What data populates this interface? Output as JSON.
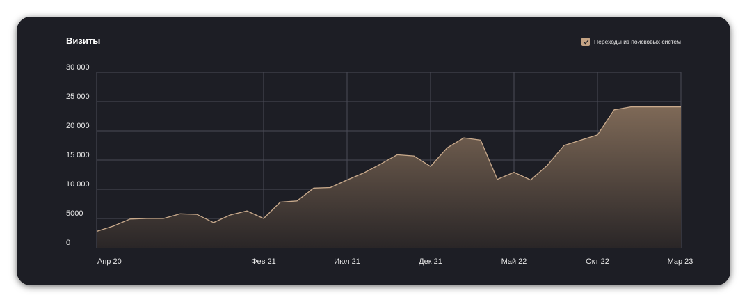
{
  "chart_data": {
    "type": "area",
    "title": "Визиты",
    "series_legend": "Переходы из поисковых систем",
    "ylim": [
      0,
      30000
    ],
    "y_ticks": [
      0,
      5000,
      10000,
      15000,
      20000,
      25000,
      30000
    ],
    "y_tick_labels": [
      "0",
      "5000",
      "10 000",
      "15 000",
      "20 000",
      "25 000",
      "30 000"
    ],
    "x_tick_labels": [
      "Апр 20",
      "Фев 21",
      "Июл 21",
      "Дек 21",
      "Май 22",
      "Окт 22",
      "Мар 23"
    ],
    "x_tick_dates": [
      "2020-04",
      "2021-02",
      "2021-07",
      "2021-12",
      "2022-05",
      "2022-10",
      "2023-03"
    ],
    "grid": true,
    "legend_position": "top-right",
    "series": [
      {
        "x": [
          "2020-04",
          "2020-05",
          "2020-06",
          "2020-07",
          "2020-08",
          "2020-09",
          "2020-10",
          "2020-11",
          "2020-12",
          "2021-01",
          "2021-02",
          "2021-03",
          "2021-04",
          "2021-05",
          "2021-06",
          "2021-07",
          "2021-08",
          "2021-09",
          "2021-10",
          "2021-11",
          "2021-12",
          "2022-01",
          "2022-02",
          "2022-03",
          "2022-04",
          "2022-05",
          "2022-06",
          "2022-07",
          "2022-08",
          "2022-09",
          "2022-10",
          "2022-11",
          "2022-12",
          "2023-01",
          "2023-02",
          "2023-03"
        ],
        "values": [
          2800,
          3700,
          4900,
          5000,
          5000,
          5800,
          5700,
          4300,
          5600,
          6300,
          5000,
          7800,
          8000,
          10200,
          10300,
          11600,
          12800,
          14300,
          15900,
          15700,
          13900,
          17100,
          18800,
          18400,
          11700,
          12900,
          11600,
          14100,
          17500,
          18400,
          19300,
          23600,
          24100,
          24100,
          24100,
          24100
        ]
      }
    ],
    "colors": {
      "card_background": "#1d1e25",
      "line": "#c9aa8c",
      "fill_top": "#7e6957",
      "fill_bottom": "#2a2627",
      "grid": "#4a4c57",
      "checkbox": "#c4a384"
    }
  }
}
